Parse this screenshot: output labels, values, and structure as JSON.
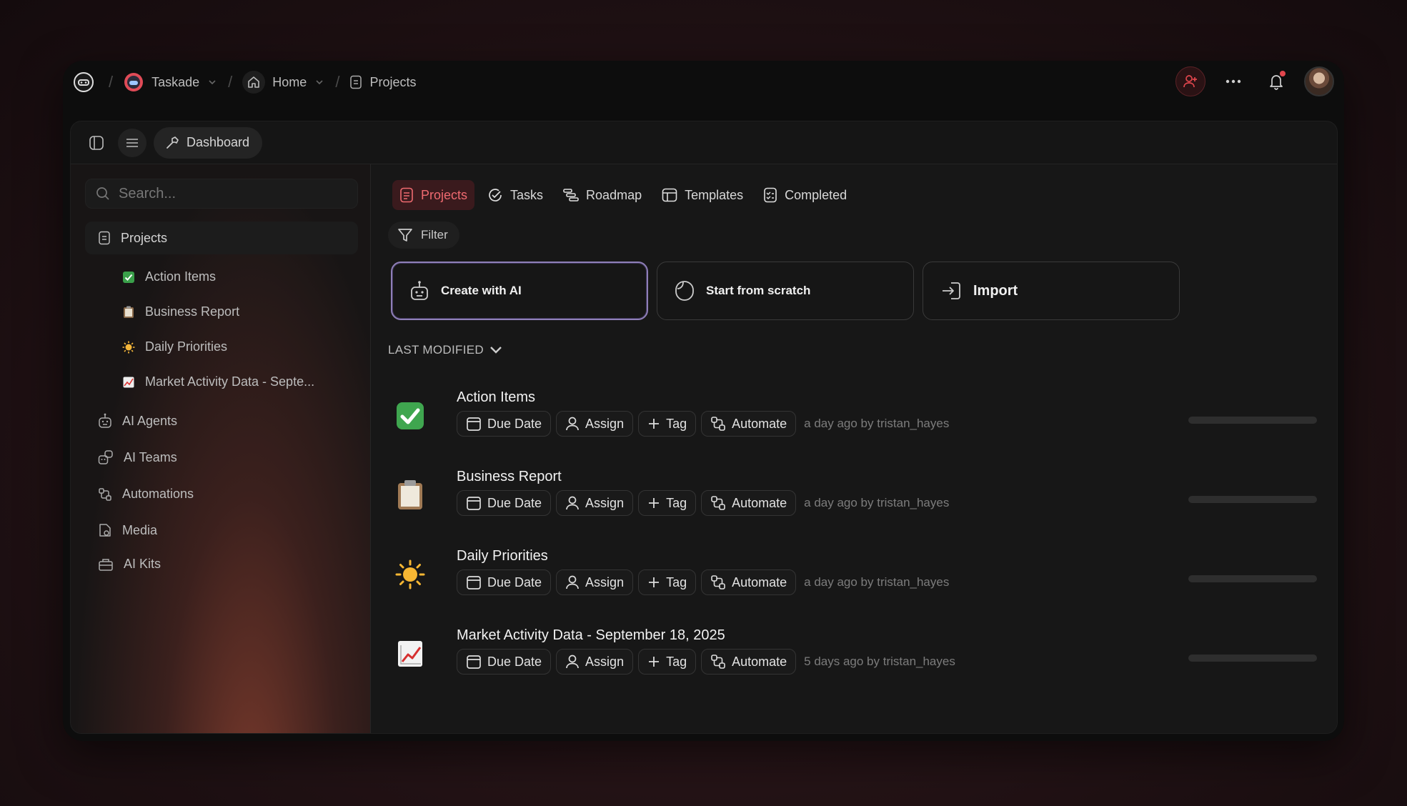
{
  "breadcrumbs": {
    "workspace": "Taskade",
    "home": "Home",
    "current": "Projects"
  },
  "toolbar": {
    "dashboard_label": "Dashboard"
  },
  "sidebar": {
    "search_placeholder": "Search...",
    "projects_label": "Projects",
    "project_items": [
      {
        "icon": "check-emoji",
        "label": "Action Items"
      },
      {
        "icon": "clipboard-emoji",
        "label": "Business Report"
      },
      {
        "icon": "sun-emoji",
        "label": "Daily Priorities"
      },
      {
        "icon": "chart-emoji",
        "label": "Market Activity Data - Septe..."
      }
    ],
    "nav_items": [
      {
        "icon": "robot-icon",
        "label": "AI Agents"
      },
      {
        "icon": "team-icon",
        "label": "AI Teams"
      },
      {
        "icon": "automation-icon",
        "label": "Automations"
      },
      {
        "icon": "media-icon",
        "label": "Media"
      },
      {
        "icon": "kit-icon",
        "label": "AI Kits"
      }
    ]
  },
  "main": {
    "tabs": [
      {
        "icon": "projects-icon",
        "label": "Projects",
        "active": true
      },
      {
        "icon": "tasks-icon",
        "label": "Tasks"
      },
      {
        "icon": "roadmap-icon",
        "label": "Roadmap"
      },
      {
        "icon": "templates-icon",
        "label": "Templates"
      },
      {
        "icon": "completed-icon",
        "label": "Completed"
      }
    ],
    "filter_label": "Filter",
    "cards": [
      {
        "label": "Create with AI"
      },
      {
        "label": "Start from scratch"
      },
      {
        "label": "Import"
      }
    ],
    "sort_label": "LAST MODIFIED",
    "chip_labels": {
      "due_date": "Due Date",
      "assign": "Assign",
      "tag": "Tag",
      "automate": "Automate"
    },
    "projects": [
      {
        "emoji": "✅",
        "title": "Action Items",
        "meta": "a day ago by tristan_hayes"
      },
      {
        "emoji": "📋",
        "title": "Business Report",
        "meta": "a day ago by tristan_hayes"
      },
      {
        "emoji": "☀️",
        "title": "Daily Priorities",
        "meta": "a day ago by tristan_hayes"
      },
      {
        "emoji": "📈",
        "title": "Market Activity Data - September 18, 2025",
        "meta": "5 days ago by tristan_hayes"
      }
    ]
  },
  "colors": {
    "accent": "#ef6a70",
    "accent_bg": "#3a1a1d",
    "notification_dot": "#e2464d",
    "ai_card_border": "#8f7fb8"
  }
}
